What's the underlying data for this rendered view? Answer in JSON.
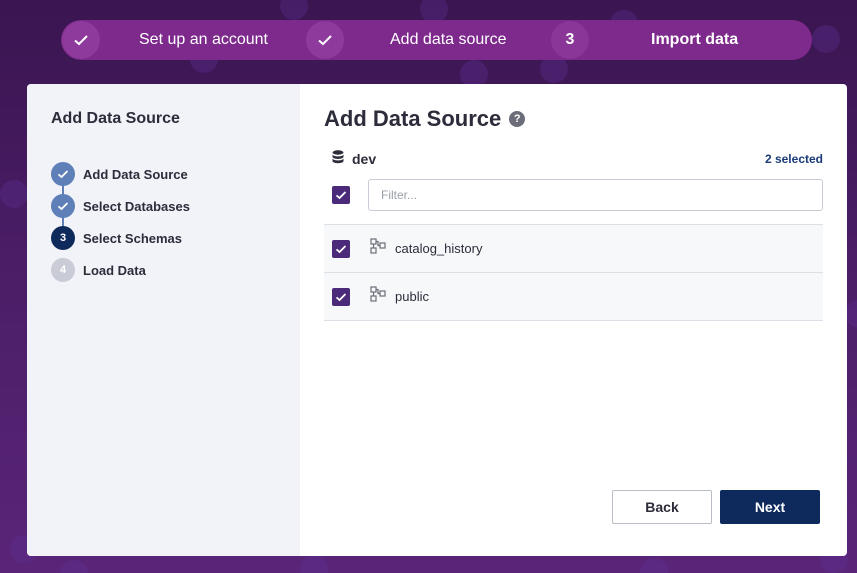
{
  "wizard": {
    "steps": [
      {
        "number": "1",
        "label": "Set up an account",
        "status": "done"
      },
      {
        "number": "2",
        "label": "Add data source",
        "status": "done"
      },
      {
        "number": "3",
        "label": "Import data",
        "status": "active"
      }
    ]
  },
  "sidebar": {
    "title": "Add Data Source",
    "steps": [
      {
        "number": "1",
        "label": "Add Data Source",
        "status": "done"
      },
      {
        "number": "2",
        "label": "Select Databases",
        "status": "done"
      },
      {
        "number": "3",
        "label": "Select Schemas",
        "status": "active"
      },
      {
        "number": "4",
        "label": "Load Data",
        "status": "pending"
      }
    ]
  },
  "main": {
    "title": "Add Data Source",
    "help_icon": "question-mark-icon",
    "database": {
      "name": "dev",
      "icon": "database-icon"
    },
    "selected_count": "2 selected",
    "select_all_checked": true,
    "filter_placeholder": "Filter...",
    "filter_value": "",
    "schemas": [
      {
        "name": "catalog_history",
        "checked": true,
        "icon": "schema-icon"
      },
      {
        "name": "public",
        "checked": true,
        "icon": "schema-icon"
      }
    ]
  },
  "buttons": {
    "back": "Back",
    "next": "Next"
  },
  "colors": {
    "stepper_bg": "#7d2a8c",
    "primary": "#0e2a5c",
    "checkbox": "#4b2a7a",
    "done_step": "#5f7fb8",
    "link_text": "#1a3a78"
  }
}
